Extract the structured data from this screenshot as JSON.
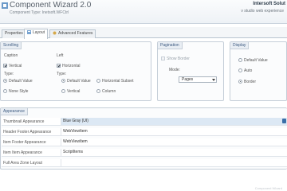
{
  "header": {
    "title": "Component Wizard 2.0",
    "subtitle": "Component Type: Inetsoft.WFCtrl",
    "brand": "Intersoft Solut",
    "url": "v studio web experience"
  },
  "tabs": [
    {
      "label": "Properties",
      "active": false
    },
    {
      "label": "Layout",
      "active": true
    },
    {
      "label": "Advanced Features",
      "active": false
    }
  ],
  "groups": {
    "scrolling": {
      "title": "Scrolling",
      "caption_label": "Caption",
      "caption_value": "Left",
      "vertical_label": "Vertical",
      "horizontal_label": "Horizontal",
      "type_label_left": "Type:",
      "type_label_right": "Type:",
      "left_options": [
        "Default Value",
        "None Style"
      ],
      "right_options": [
        "Default Value",
        "Horizontal Subset",
        "Vertical",
        "Column"
      ]
    },
    "pagination": {
      "title": "Pagination",
      "enable_label": "Show Border",
      "mode_label": "Mode:",
      "mode_value": "Pages"
    },
    "display": {
      "title": "Display",
      "options": [
        "Default Value",
        "Auto",
        "Border"
      ]
    }
  },
  "grid": {
    "title": "Appearance",
    "rows": [
      {
        "key": "Thumbnail Appearance",
        "value": "Blue Gray (UI)"
      },
      {
        "key": "Header Footer Appearance",
        "value": "WebViewItem"
      },
      {
        "key": "Item Footer Appearance",
        "value": "WebViewItem"
      },
      {
        "key": "Item Item Appearance",
        "value": "ScriptItems"
      },
      {
        "key": "Full Area Zone Layout",
        "value": ""
      }
    ]
  },
  "footer": {
    "text": "Component Wizard"
  },
  "colors": {
    "accent": "#3b6fa8",
    "banner_border": "#c9d3dd",
    "selection": "#dce8f4"
  }
}
